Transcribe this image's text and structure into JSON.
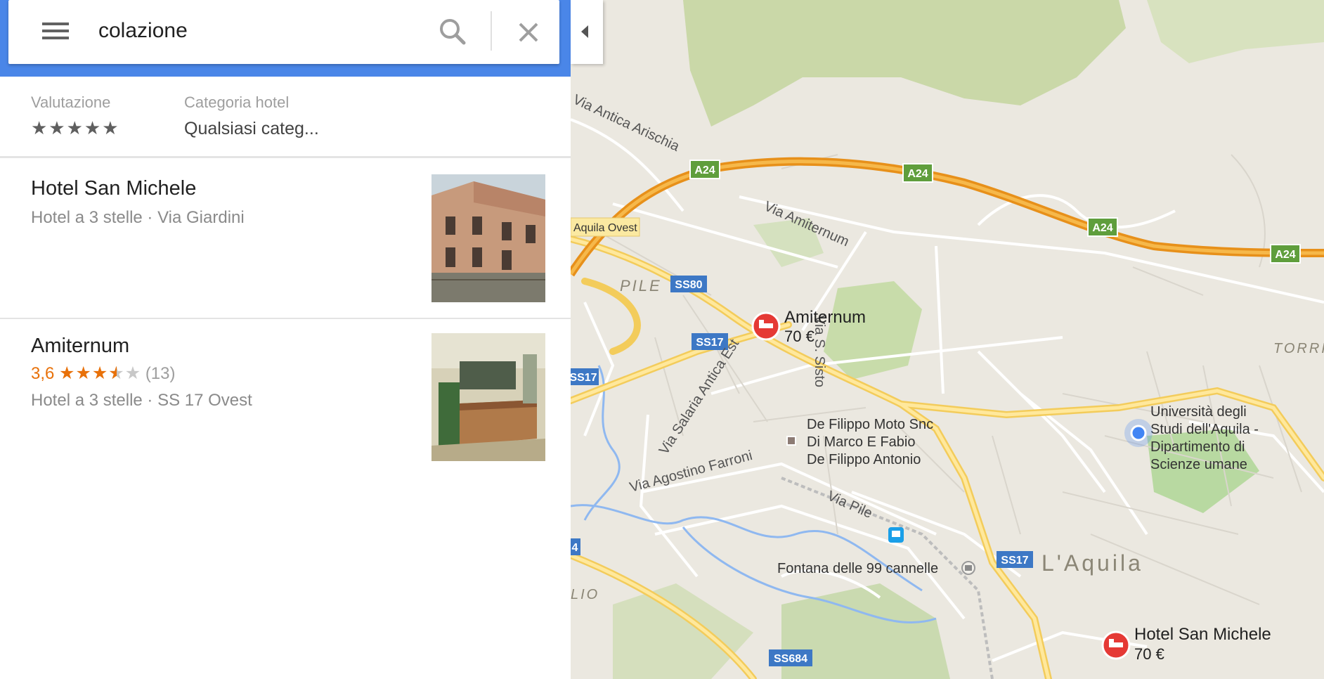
{
  "search": {
    "query": "colazione"
  },
  "filters": {
    "rating": {
      "label": "Valutazione",
      "stars": "★★★★★"
    },
    "category": {
      "label": "Categoria hotel",
      "value": "Qualsiasi categ..."
    }
  },
  "results": [
    {
      "name": "Hotel San Michele",
      "subtitle": "Hotel a 3 stelle · Via Giardini"
    },
    {
      "name": "Amiternum",
      "rating": "3,6",
      "rating_value": 3.6,
      "reviews": "(13)",
      "subtitle": "Hotel a 3 stelle · SS 17 Ovest"
    }
  ],
  "map": {
    "roads": {
      "via_antica_arischia": "Via Antica Arischia",
      "via_amiternum": "Via Amiternum",
      "via_s_sisto": "Via S. Sisto",
      "via_salaria_antica_est": "Via Salaria Antica Est",
      "via_agostino_farroni": "Via Agostino Farroni",
      "via_pile": "Via Pile",
      "aquila_ovest": "Aquila Ovest"
    },
    "shields": {
      "a24": "A24",
      "ss80": "SS80",
      "ss17": "SS17",
      "ss684": "SS684"
    },
    "areas": {
      "pile": "PILE",
      "laquila": "L'Aquila",
      "torri": "TORRI",
      "lio": "LIO",
      "shield_cut": "4"
    },
    "hotels": [
      {
        "name": "Amiternum",
        "price": "70 €"
      },
      {
        "name": "Hotel San Michele",
        "price": "70 €"
      }
    ],
    "pois": {
      "moto_line1": "De Filippo Moto Snc",
      "moto_line2": "Di Marco E Fabio",
      "moto_line3": "De Filippo Antonio",
      "fontana": "Fontana delle 99 cannelle",
      "uni_line1": "Università degli",
      "uni_line2": "Studi dell'Aquila -",
      "uni_line3": "Dipartimento di",
      "uni_line4": "Scienze umane"
    }
  }
}
